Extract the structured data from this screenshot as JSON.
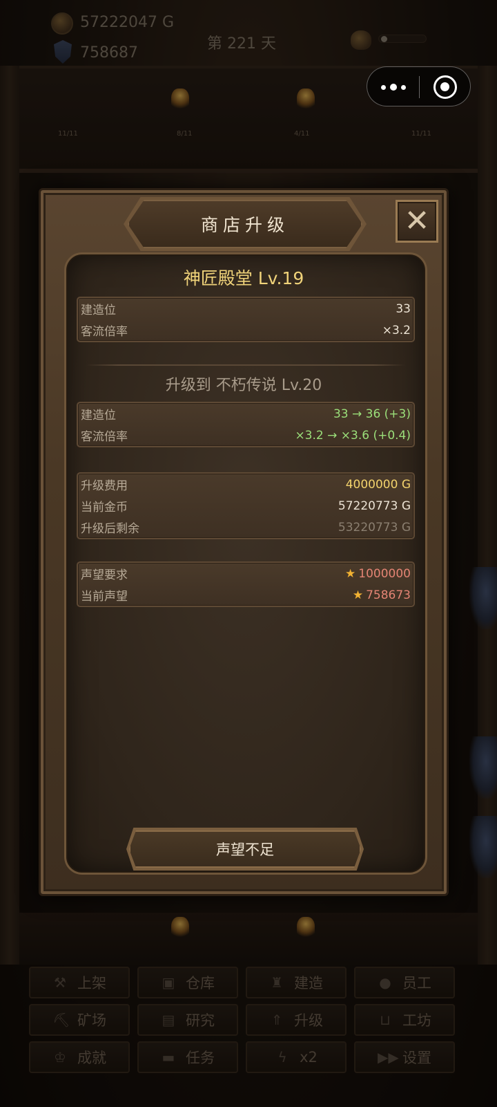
{
  "hud": {
    "gold": "57222047 G",
    "reputation": "758687",
    "day": "第 221 天"
  },
  "slots": [
    "11/11",
    "8/11",
    "4/11",
    "11/11"
  ],
  "modal": {
    "title": "商店升级",
    "close": "✕",
    "current": {
      "name": "神匠殿堂  Lv.19",
      "rows": [
        {
          "label": "建造位",
          "value": "33"
        },
        {
          "label": "客流倍率",
          "value": "×3.2"
        }
      ]
    },
    "upgrade_to": "升级到  不朽传说  Lv.20",
    "changes": [
      {
        "label": "建造位",
        "value": "33 → 36  (+3)"
      },
      {
        "label": "客流倍率",
        "value": "×3.2 → ×3.6  (+0.4)"
      }
    ],
    "cost": [
      {
        "label": "升级费用",
        "value": "4000000 G"
      },
      {
        "label": "当前金币",
        "value": "57220773 G"
      },
      {
        "label": "升级后剩余",
        "value": "53220773 G"
      }
    ],
    "reputation": [
      {
        "label": "声望要求",
        "value": "1000000"
      },
      {
        "label": "当前声望",
        "value": "758673"
      }
    ],
    "star": "★",
    "action_label": "声望不足"
  },
  "nav": [
    {
      "label": "上架",
      "icon": "hammer-icon",
      "glyph": "⚒"
    },
    {
      "label": "仓库",
      "icon": "box-icon",
      "glyph": "▣"
    },
    {
      "label": "建造",
      "icon": "building-icon",
      "glyph": "♜"
    },
    {
      "label": "员工",
      "icon": "person-icon",
      "glyph": "●"
    },
    {
      "label": "矿场",
      "icon": "pickaxe-icon",
      "glyph": "⛏"
    },
    {
      "label": "研究",
      "icon": "book-icon",
      "glyph": "▤"
    },
    {
      "label": "升级",
      "icon": "chevrons-up-icon",
      "glyph": "⇑"
    },
    {
      "label": "工坊",
      "icon": "cart-icon",
      "glyph": "⊔"
    },
    {
      "label": "成就",
      "icon": "trophy-icon",
      "glyph": "♔"
    },
    {
      "label": "任务",
      "icon": "task-icon",
      "glyph": "▬"
    },
    {
      "label": "x2",
      "icon": "lightning-icon",
      "glyph": "ϟ"
    },
    {
      "label": "设置",
      "icon": "fast-forward-icon",
      "glyph": "▶▶"
    }
  ]
}
